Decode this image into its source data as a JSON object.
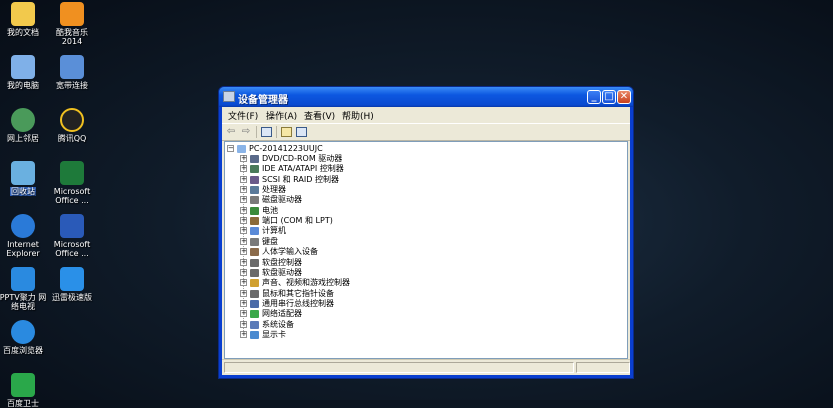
{
  "desktop_icons": [
    {
      "label": "我的文档",
      "icon": "my-documents-icon",
      "color": "#f2c94c"
    },
    {
      "label": "酷我音乐\n2014",
      "icon": "kuwo-music-icon",
      "color": "#f09020"
    },
    {
      "label": "我的电脑",
      "icon": "my-computer-icon",
      "color": "#7fb0e8"
    },
    {
      "label": "宽带连接",
      "icon": "broadband-connection-icon",
      "color": "#5a8fd8"
    },
    {
      "label": "网上邻居",
      "icon": "network-places-icon",
      "color": "#4a9a5a"
    },
    {
      "label": "腾讯QQ",
      "icon": "tencent-qq-icon",
      "color": "#222222"
    },
    {
      "label": "回收站",
      "icon": "recycle-bin-icon",
      "color": "#6ab0e0"
    },
    {
      "label": "Microsoft\nOffice ...",
      "icon": "excel-icon",
      "color": "#1e7a3a"
    },
    {
      "label": "Internet\nExplorer",
      "icon": "internet-explorer-icon",
      "color": "#2a7ad8"
    },
    {
      "label": "Microsoft\nOffice ...",
      "icon": "word-icon",
      "color": "#2a5ab8"
    },
    {
      "label": "PPTV聚力 网\n络电视",
      "icon": "pptv-icon",
      "color": "#2a8ae0"
    },
    {
      "label": "迅雷极速版",
      "icon": "thunder-icon",
      "color": "#2a90e8"
    },
    {
      "label": "百度浏览器",
      "icon": "baidu-browser-icon",
      "color": "#2a8ae0"
    },
    {
      "label": "百度卫士",
      "icon": "baidu-guard-icon",
      "color": "#2aa84a"
    }
  ],
  "window": {
    "title": "设备管理器",
    "menu": [
      "文件(F)",
      "操作(A)",
      "查看(V)",
      "帮助(H)"
    ],
    "root": "PC-20141223UUJC",
    "devices": [
      "DVD/CD-ROM 驱动器",
      "IDE ATA/ATAPI 控制器",
      "SCSI 和 RAID 控制器",
      "处理器",
      "磁盘驱动器",
      "电池",
      "端口 (COM 和 LPT)",
      "计算机",
      "键盘",
      "人体学输入设备",
      "软盘控制器",
      "软盘驱动器",
      "声音、视频和游戏控制器",
      "鼠标和其它指针设备",
      "通用串行总线控制器",
      "网络适配器",
      "系统设备",
      "显示卡"
    ]
  }
}
